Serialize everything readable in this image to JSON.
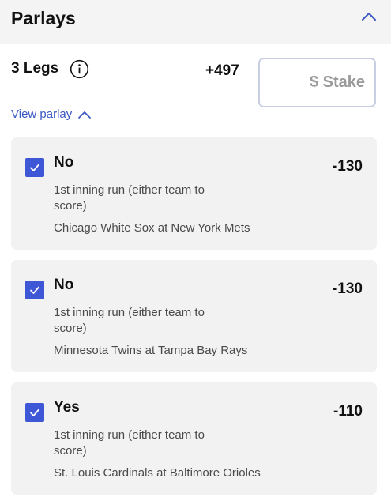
{
  "header": {
    "title": "Parlays"
  },
  "summary": {
    "legs_label": "3 Legs",
    "total_odds": "+497",
    "stake_placeholder": "$ Stake",
    "view_parlay_label": "View parlay"
  },
  "legs": [
    {
      "selection": "No",
      "odds": "-130",
      "market": "1st inning run (either team to score)",
      "event": "Chicago White Sox at New York Mets",
      "checked": true
    },
    {
      "selection": "No",
      "odds": "-130",
      "market": "1st inning run (either team to score)",
      "event": "Minnesota Twins at Tampa Bay Rays",
      "checked": true
    },
    {
      "selection": "Yes",
      "odds": "-110",
      "market": "1st inning run (either team to score)",
      "event": "St. Louis Cardinals at Baltimore Orioles",
      "checked": true
    }
  ],
  "colors": {
    "accent": "#3d57d6",
    "link": "#3b57c4",
    "card_background": "#f2f2f2",
    "header_background": "#f4f4f4"
  },
  "icons": {
    "collapse": "chevron-up-icon",
    "info": "info-icon",
    "checkbox": "checkmark-icon"
  }
}
